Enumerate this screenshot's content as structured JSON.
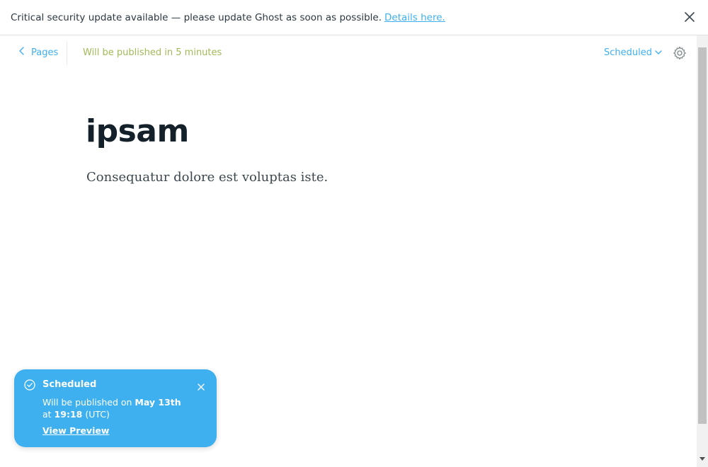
{
  "alert": {
    "message": "Critical security update available — please update Ghost as soon as possible.",
    "link_text": "Details here."
  },
  "header": {
    "back_label": "Pages",
    "publish_status": "Will be published in 5 minutes",
    "status_dropdown_label": "Scheduled"
  },
  "post": {
    "title": "ipsam",
    "body": "Consequatur dolore est voluptas iste."
  },
  "toast": {
    "title": "Scheduled",
    "msg_prefix": "Will be published on ",
    "date": "May 13th",
    "at": "at ",
    "time": "19:18",
    "timezone": " (UTC)",
    "link_text": "View Preview"
  },
  "colors": {
    "accent": "#3eb0ef",
    "published_green": "#9fbb58",
    "toast_bg": "#3eb0ef"
  },
  "icons": {
    "alert_close": "close-icon",
    "back": "chevron-left-icon",
    "dropdown": "chevron-down-icon",
    "settings": "gear-icon",
    "toast_check": "check-circle-icon",
    "toast_close": "close-icon"
  }
}
